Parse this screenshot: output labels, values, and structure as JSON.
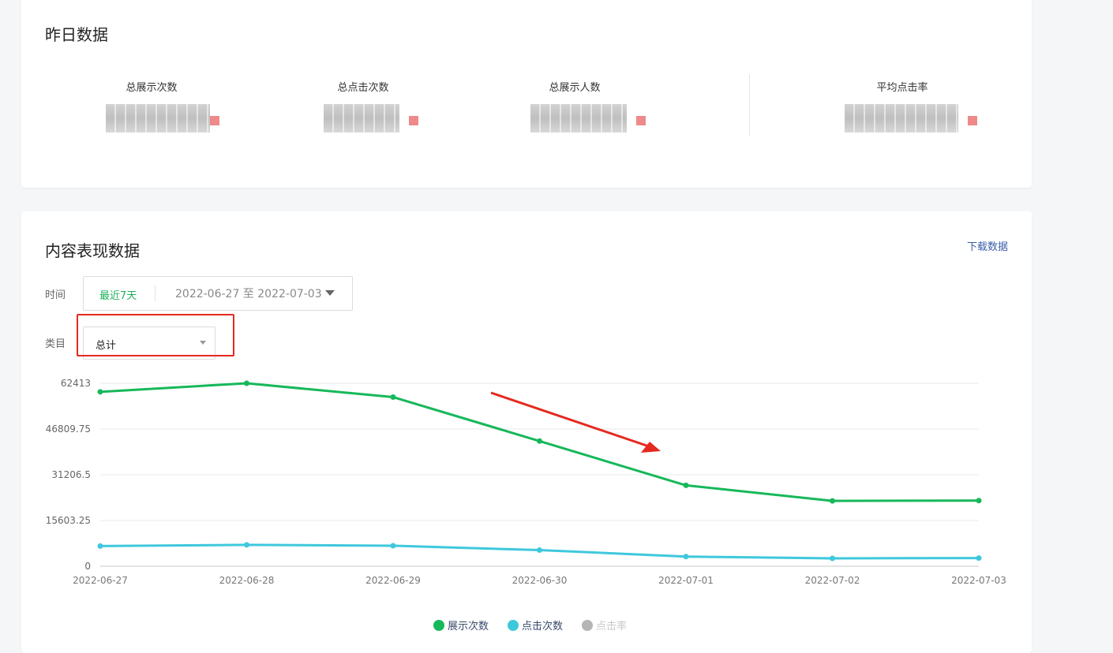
{
  "yesterday": {
    "title": "昨日数据",
    "metrics": [
      {
        "label": "总展示次数"
      },
      {
        "label": "总点击次数"
      },
      {
        "label": "总展示人数"
      },
      {
        "label": "平均点击率"
      }
    ]
  },
  "content": {
    "title": "内容表现数据",
    "download_label": "下载数据",
    "time_label": "时间",
    "quick_range": "最近7天",
    "date_range": "2022-06-27 至 2022-07-03",
    "category_label": "类目",
    "category_value": "总计"
  },
  "colors": {
    "green": "#16b85a",
    "cyan": "#3ec8dd",
    "gray": "#b5b5b5",
    "annotation_red": "#e42a1f"
  },
  "chart_data": {
    "type": "line",
    "categories": [
      "2022-06-27",
      "2022-06-28",
      "2022-06-29",
      "2022-06-30",
      "2022-07-01",
      "2022-07-02",
      "2022-07-03"
    ],
    "y_ticks": [
      "0",
      "15603.25",
      "31206.5",
      "46809.75",
      "62413"
    ],
    "ylim": [
      0,
      62413
    ],
    "grid": true,
    "legend_position": "bottom",
    "series": [
      {
        "name": "展示次数",
        "color": "#16b85a",
        "values": [
          59500,
          62413,
          57700,
          42700,
          27600,
          22300,
          22400
        ]
      },
      {
        "name": "点击次数",
        "color": "#3ec8dd",
        "values": [
          6900,
          7300,
          7000,
          5500,
          3300,
          2700,
          2800
        ]
      },
      {
        "name": "点击率",
        "color": "#b5b5b5",
        "values": [],
        "disabled": true
      }
    ]
  }
}
